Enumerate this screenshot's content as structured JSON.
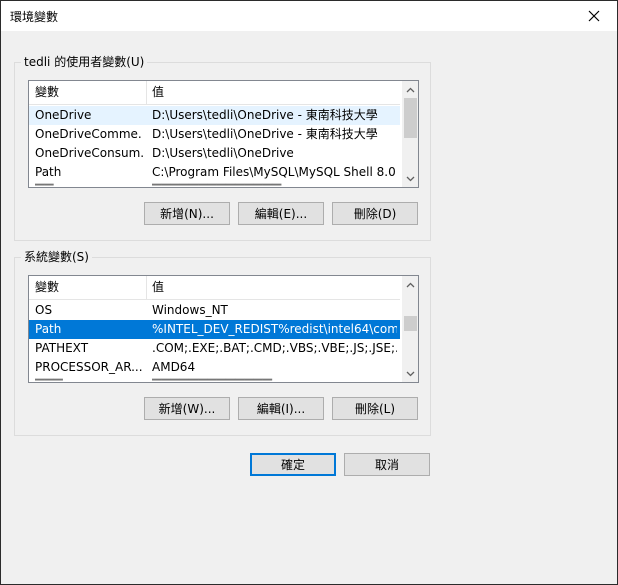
{
  "window": {
    "title": "環境變數"
  },
  "user_vars": {
    "group_label": "tedli 的使用者變數(U)",
    "columns": [
      "變數",
      "值"
    ],
    "rows": [
      {
        "name": "OneDrive",
        "value": "D:\\Users\\tedli\\OneDrive - 東南科技大學"
      },
      {
        "name": "OneDriveComme...",
        "value": "D:\\Users\\tedli\\OneDrive - 東南科技大學"
      },
      {
        "name": "OneDriveConsum...",
        "value": "D:\\Users\\tedli\\OneDrive"
      },
      {
        "name": "Path",
        "value": "C:\\Program Files\\MySQL\\MySQL Shell 8.0..."
      }
    ],
    "buttons": {
      "new": "新增(N)...",
      "edit": "編輯(E)...",
      "delete": "刪除(D)"
    }
  },
  "system_vars": {
    "group_label": "系統變數(S)",
    "columns": [
      "變數",
      "值"
    ],
    "rows": [
      {
        "name": "OS",
        "value": "Windows_NT"
      },
      {
        "name": "Path",
        "value": "%INTEL_DEV_REDIST%redist\\intel64\\com..."
      },
      {
        "name": "PATHEXT",
        "value": ".COM;.EXE;.BAT;.CMD;.VBS;.VBE;.JS;.JSE;...."
      },
      {
        "name": "PROCESSOR_AR...",
        "value": "AMD64"
      }
    ],
    "selected_row": "Path",
    "buttons": {
      "new": "新增(W)...",
      "edit": "編輯(I)...",
      "delete": "刪除(L)"
    }
  },
  "dialog_buttons": {
    "ok": "確定",
    "cancel": "取消"
  },
  "colors": {
    "selection": "#0078d7",
    "hover": "#e5f3ff"
  }
}
